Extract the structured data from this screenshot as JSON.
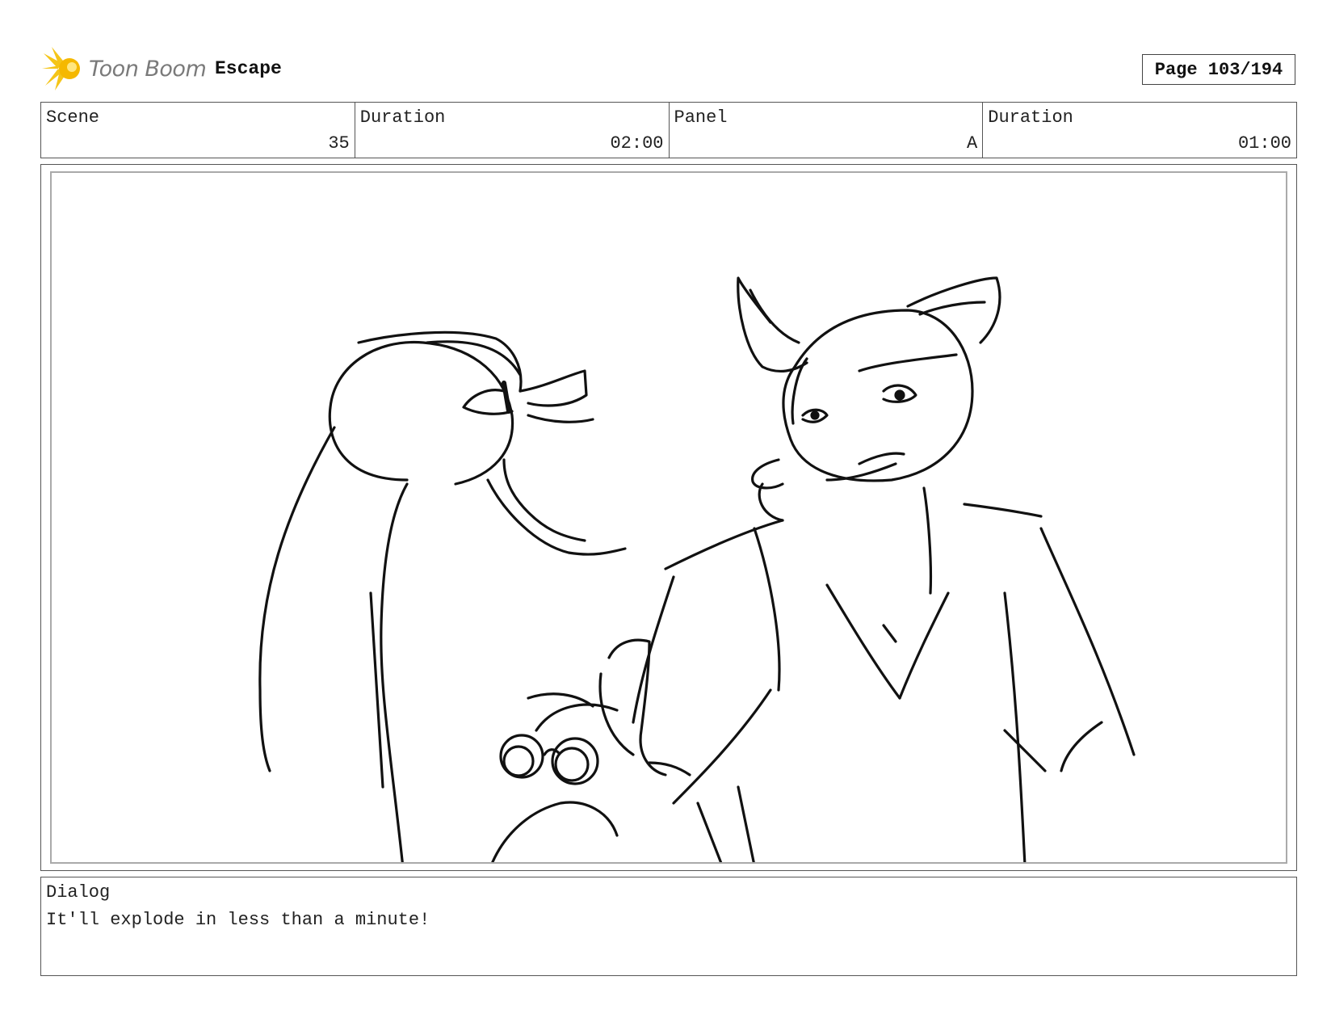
{
  "header": {
    "brand": "Toon Boom",
    "project": "Escape",
    "page": "Page 103/194",
    "logo_icon": "toon-boom-star-logo",
    "logo_color": "#f5c518"
  },
  "info": {
    "scene_label": "Scene",
    "scene_value": "35",
    "scene_duration_label": "Duration",
    "scene_duration_value": "02:00",
    "panel_label": "Panel",
    "panel_value": "A",
    "panel_duration_label": "Duration",
    "panel_duration_value": "01:00"
  },
  "dialog": {
    "label": "Dialog",
    "text": "It'll explode in less than a minute!"
  }
}
